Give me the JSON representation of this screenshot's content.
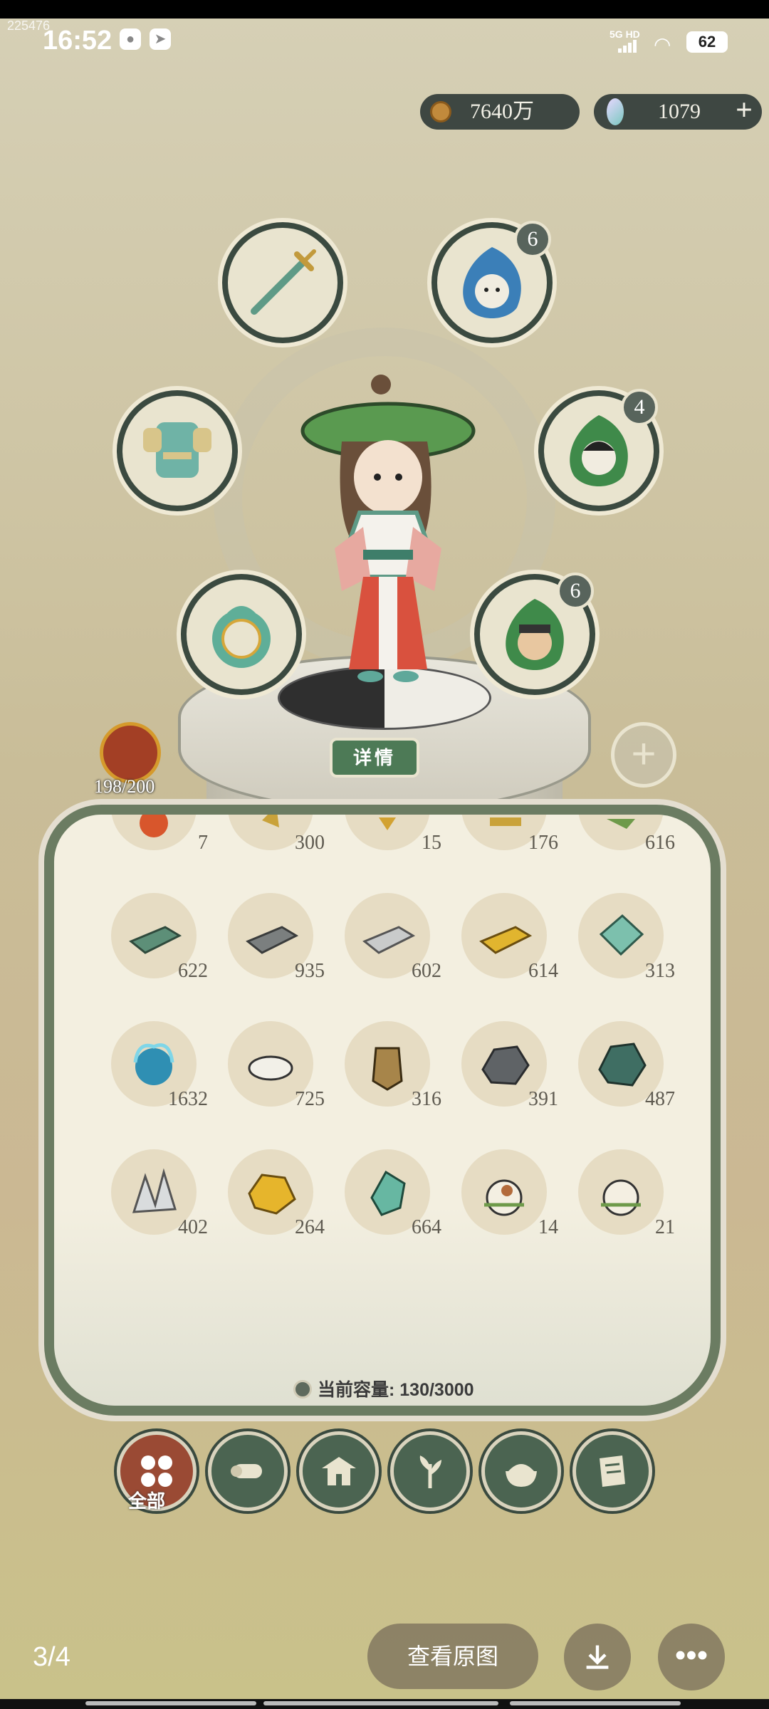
{
  "status": {
    "time": "16:52",
    "network": "5G HD",
    "battery": "62",
    "corner_tag": "225476"
  },
  "currency": {
    "coins": "7640万",
    "gems": "1079"
  },
  "equipment_badges": {
    "right_top": "6",
    "right_mid": "4",
    "right_bottom": "6"
  },
  "detail_button": "详情",
  "pet_count": "198/200",
  "items": [
    {
      "count": "7"
    },
    {
      "count": "300"
    },
    {
      "count": "15"
    },
    {
      "count": "176"
    },
    {
      "count": "616"
    },
    {
      "count": "622"
    },
    {
      "count": "935"
    },
    {
      "count": "602"
    },
    {
      "count": "614"
    },
    {
      "count": "313"
    },
    {
      "count": "1632"
    },
    {
      "count": "725"
    },
    {
      "count": "316"
    },
    {
      "count": "391"
    },
    {
      "count": "487"
    },
    {
      "count": "402"
    },
    {
      "count": "264"
    },
    {
      "count": "664"
    },
    {
      "count": "14"
    },
    {
      "count": "21"
    }
  ],
  "capacity": "当前容量: 130/3000",
  "tabs": {
    "all_label": "全部"
  },
  "viewer": {
    "counter": "3/4",
    "view_original": "查看原图"
  },
  "colors": {
    "frame": "#6b7c62",
    "tab": "#4b6451",
    "tab_active": "#9a4a34",
    "currency_bg": "#3e4742"
  }
}
